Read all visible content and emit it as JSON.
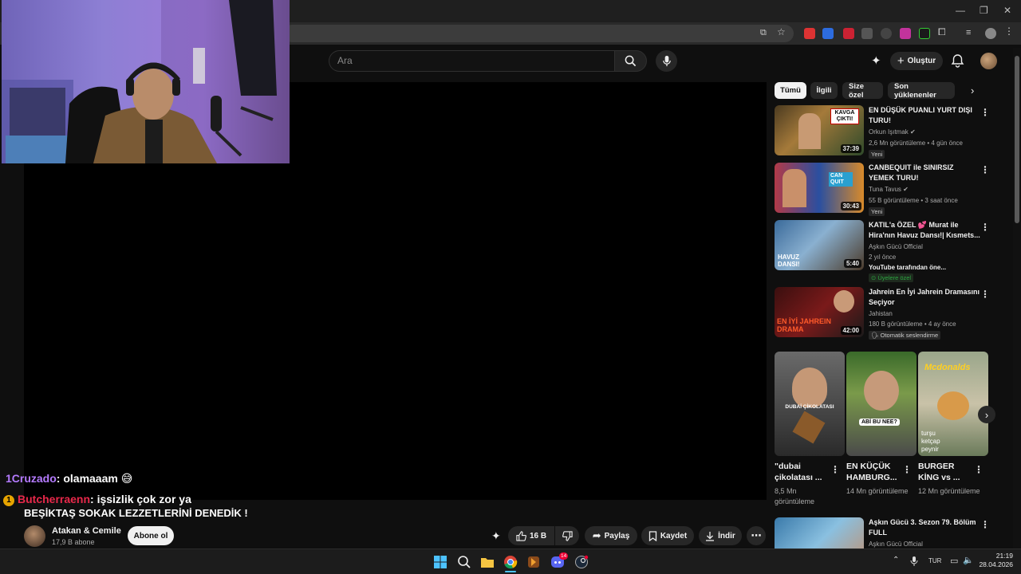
{
  "search": {
    "placeholder": "Ara"
  },
  "header": {
    "create_label": "Oluştur"
  },
  "chat": [
    {
      "user": "1Cruzado",
      "text": ": olamaaam 😅",
      "user_color": "#b57bff"
    },
    {
      "badge": "1",
      "user": "Butcherraenn",
      "text": ": işsizlik çok zor ya",
      "user_color": "#e8284a"
    }
  ],
  "video": {
    "title": "BEŞİKTAŞ SOKAK LEZZETLERİNİ DENEDİK !",
    "channel": "Atakan & Cemile",
    "subscribers": "17,9 B abone",
    "subscribe_label": "Abone ol",
    "likes": "16 B",
    "share_label": "Paylaş",
    "save_label": "Kaydet",
    "download_label": "İndir"
  },
  "chips": [
    "Tümü",
    "İlgili",
    "Size özel",
    "Son yüklenenler"
  ],
  "recommendations": [
    {
      "title": "EN DÜŞÜK PUANLI YURT DIŞI TURU!",
      "channel": "Orkun Işıtmak",
      "verified": true,
      "meta": "2,6 Mn görüntüleme • 4 gün önce",
      "tag": "Yeni",
      "duration": "37:39",
      "thumb_text": "KAVGA ÇIKTI!"
    },
    {
      "title": "CANBEQUIT ile SINIRSIZ YEMEK TURU!",
      "channel": "Tuna Tavus",
      "verified": true,
      "meta": "55 B görüntüleme • 3 saat önce",
      "tag": "Yeni",
      "duration": "30:43",
      "thumb_text": "CAN QUIT"
    },
    {
      "title": "KATIL'a ÖZEL 💕 Murat ile Hira'nın Havuz Dansı!| Kısmets...",
      "channel": "Aşkın Gücü Official",
      "verified": false,
      "meta": "2 yıl önce",
      "extra": "YouTube tarafından öne...",
      "tag": "Üyelere özel",
      "duration": "5:40",
      "thumb_text": "HAVUZ DANSI!"
    },
    {
      "title": "Jahrein En İyi Jahrein Dramasını Seçiyor",
      "channel": "Jahistan",
      "verified": false,
      "meta": "180 B görüntüleme • 4 ay önce",
      "tag": "Otomatik seslendirme",
      "duration": "42:00",
      "thumb_text": "EN İYİ JAHREIN DRAMA"
    },
    {
      "title": "Aşkın Gücü 3. Sezon 79. Bölüm FULL",
      "channel": "Aşkın Gücü Official"
    }
  ],
  "shorts": [
    {
      "title": "\"dubai çikolatası ...",
      "views": "8,5 Mn görüntüleme",
      "overlay": "DUBAİ ÇİKOLATASI"
    },
    {
      "title": "EN KÜÇÜK HAMBURG...",
      "views": "14 Mn görüntüleme",
      "overlay": "ABİ BU NEE?"
    },
    {
      "title": "BURGER KİNG vs ...",
      "views": "12 Mn görüntüleme",
      "overlay": "Mcdonalds",
      "overlay2": "turşu ketçap peynir"
    }
  ],
  "taskbar": {
    "lang": "TUR",
    "time": "21:19",
    "date": "28.04.2026",
    "discord_badge": "14"
  }
}
